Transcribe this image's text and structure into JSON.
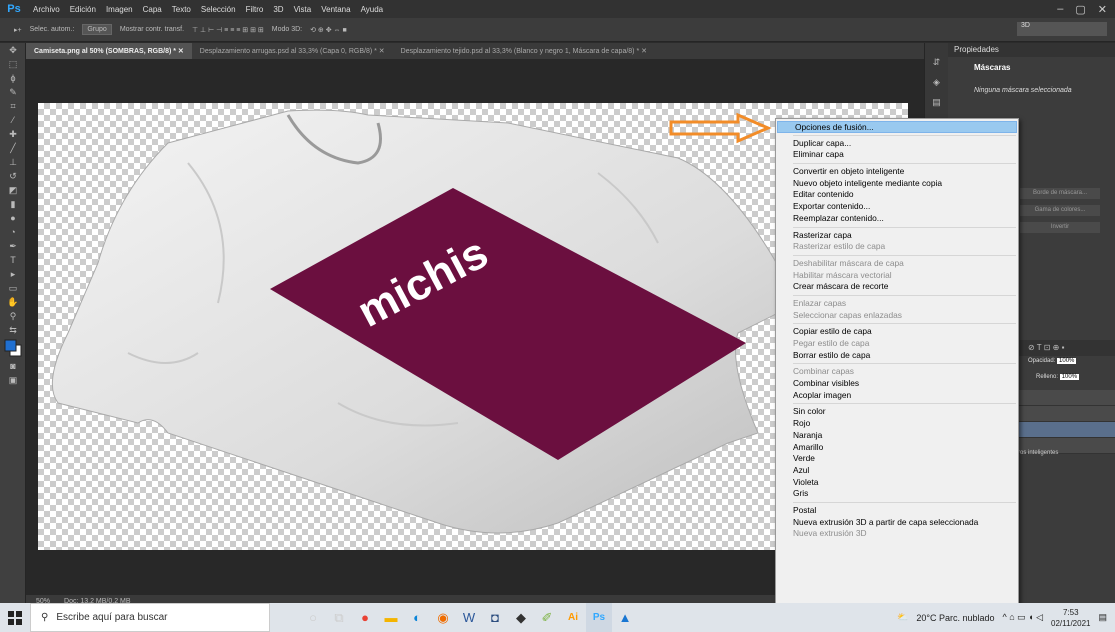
{
  "app": {
    "logo": "Ps",
    "menu": [
      "Archivo",
      "Edición",
      "Imagen",
      "Capa",
      "Texto",
      "Selección",
      "Filtro",
      "3D",
      "Vista",
      "Ventana",
      "Ayuda"
    ],
    "window_controls": [
      "–",
      "▢",
      "✕"
    ]
  },
  "options_bar": {
    "auto_select": "Selec. autom.:",
    "group": "Grupo",
    "transform": "Mostrar contr. transf.",
    "mode3d": "Modo 3D:",
    "workspace": "3D"
  },
  "tabs": [
    {
      "label": "Camiseta.png al 50% (SOMBRAS, RGB/8) *"
    },
    {
      "label": "Desplazamiento arrugas.psd al 33,3% (Capa 0, RGB/8) *"
    },
    {
      "label": "Desplazamiento tejido.psd al 33,3% (Blanco y negro 1, Máscara de capa/8) *"
    }
  ],
  "canvas": {
    "shirt_text": "michis",
    "shirt_print_color": "#6b0f3f"
  },
  "status": {
    "zoom": "50%",
    "doc": "Doc: 13,2 MB/0,2 MB"
  },
  "properties": {
    "header": "Propiedades",
    "title": "Máscaras",
    "no_mask": "Ninguna máscara seleccionada",
    "btn_mask_edge": "Borde de máscara...",
    "btn_color_range": "Gama de colores...",
    "btn_invert": "Invertir"
  },
  "layers": {
    "opacity_label": "Opacidad:",
    "opacity_value": "100%",
    "fill_label": "Relleno:",
    "fill_value": "100%",
    "smart_label": "ros inteligentes"
  },
  "context_menu": {
    "groups": [
      [
        {
          "label": "Opciones de fusión...",
          "state": "highlight"
        }
      ],
      [
        {
          "label": "Duplicar capa...",
          "state": "normal"
        },
        {
          "label": "Eliminar capa",
          "state": "normal"
        }
      ],
      [
        {
          "label": "Convertir en objeto inteligente",
          "state": "normal"
        },
        {
          "label": "Nuevo objeto inteligente mediante copia",
          "state": "normal"
        },
        {
          "label": "Editar contenido",
          "state": "normal"
        },
        {
          "label": "Exportar contenido...",
          "state": "normal"
        },
        {
          "label": "Reemplazar contenido...",
          "state": "normal"
        }
      ],
      [
        {
          "label": "Rasterizar capa",
          "state": "normal"
        },
        {
          "label": "Rasterizar estilo de capa",
          "state": "disabled"
        }
      ],
      [
        {
          "label": "Deshabilitar máscara de capa",
          "state": "disabled"
        },
        {
          "label": "Habilitar máscara vectorial",
          "state": "disabled"
        },
        {
          "label": "Crear máscara de recorte",
          "state": "normal"
        }
      ],
      [
        {
          "label": "Enlazar capas",
          "state": "disabled"
        },
        {
          "label": "Seleccionar capas enlazadas",
          "state": "disabled"
        }
      ],
      [
        {
          "label": "Copiar estilo de capa",
          "state": "normal"
        },
        {
          "label": "Pegar estilo de capa",
          "state": "disabled"
        },
        {
          "label": "Borrar estilo de capa",
          "state": "normal"
        }
      ],
      [
        {
          "label": "Combinar capas",
          "state": "disabled"
        },
        {
          "label": "Combinar visibles",
          "state": "normal"
        },
        {
          "label": "Acoplar imagen",
          "state": "normal"
        }
      ],
      [
        {
          "label": "Sin color",
          "state": "normal"
        },
        {
          "label": "Rojo",
          "state": "normal"
        },
        {
          "label": "Naranja",
          "state": "normal"
        },
        {
          "label": "Amarillo",
          "state": "normal"
        },
        {
          "label": "Verde",
          "state": "normal"
        },
        {
          "label": "Azul",
          "state": "normal"
        },
        {
          "label": "Violeta",
          "state": "normal"
        },
        {
          "label": "Gris",
          "state": "normal"
        }
      ],
      [
        {
          "label": "Postal",
          "state": "normal"
        },
        {
          "label": "Nueva extrusión 3D a partir de capa seleccionada",
          "state": "normal"
        },
        {
          "label": "Nueva extrusión 3D",
          "state": "disabled"
        }
      ]
    ]
  },
  "taskbar": {
    "search_placeholder": "Escribe aquí para buscar",
    "weather": "20°C Parc. nublado",
    "time": "7:53",
    "date": "02/11/2021"
  },
  "colors": {
    "arrow": "#f28c28",
    "highlight": "#99c9ef"
  }
}
